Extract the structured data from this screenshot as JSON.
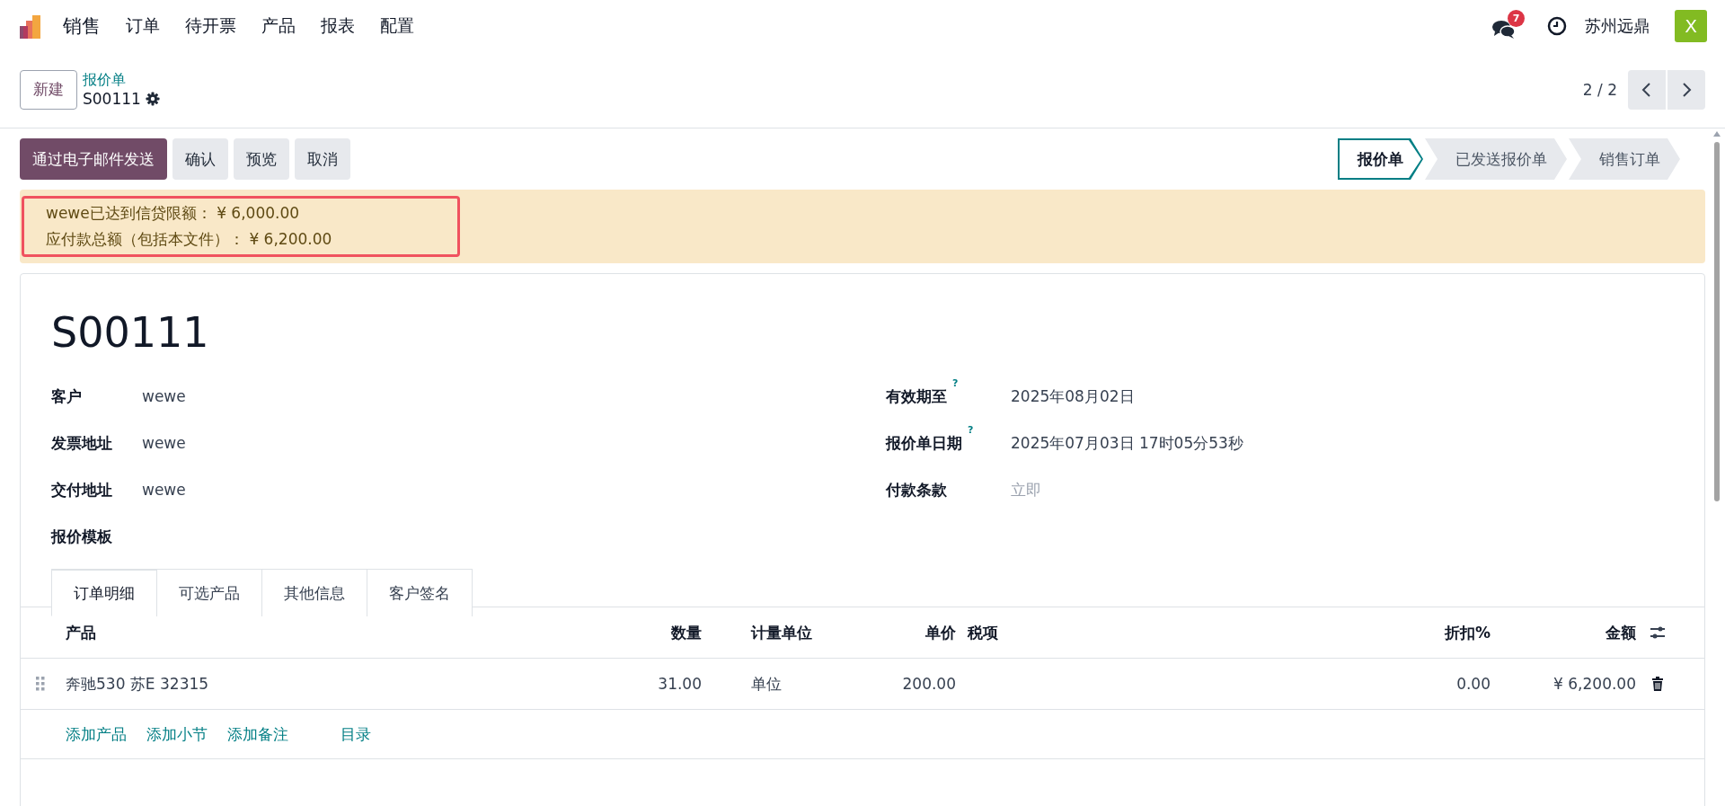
{
  "navbar": {
    "app_name": "销售",
    "menu": [
      "订单",
      "待开票",
      "产品",
      "报表",
      "配置"
    ],
    "message_count": "7",
    "company": "苏州远鼎",
    "avatar": "X"
  },
  "control_panel": {
    "new_button": "新建",
    "breadcrumb": "报价单",
    "record": "S00111",
    "pager": "2 / 2"
  },
  "actions": [
    {
      "label": "通过电子邮件发送",
      "kind": "primary"
    },
    {
      "label": "确认",
      "kind": "secondary"
    },
    {
      "label": "预览",
      "kind": "secondary"
    },
    {
      "label": "取消",
      "kind": "secondary"
    }
  ],
  "status_steps": [
    {
      "label": "报价单",
      "selected": true
    },
    {
      "label": "已发送报价单",
      "selected": false
    },
    {
      "label": "销售订单",
      "selected": false
    }
  ],
  "alert": {
    "highlighted": true,
    "lines": [
      "wewe已达到信贷限额： ¥ 6,000.00",
      "应付款总额（包括本文件）： ¥ 6,200.00"
    ]
  },
  "form": {
    "title": "S00111",
    "left_fields": [
      {
        "label": "客户",
        "value": "wewe"
      },
      {
        "label": "发票地址",
        "value": "wewe"
      },
      {
        "label": "交付地址",
        "value": "wewe"
      },
      {
        "label": "报价模板"
      }
    ],
    "right_fields": [
      {
        "label": "有效期至",
        "help": "?",
        "value": "2025年08月02日"
      },
      {
        "label": "报价单日期",
        "help": "?",
        "value": "2025年07月03日 17时05分53秒"
      },
      {
        "label": "付款条款",
        "placeholder": "立即"
      }
    ]
  },
  "tabs": [
    {
      "label": "订单明细",
      "selected": true
    },
    {
      "label": "可选产品",
      "selected": false
    },
    {
      "label": "其他信息",
      "selected": false
    },
    {
      "label": "客户签名",
      "selected": false
    }
  ],
  "table": {
    "columns": [
      "产品",
      "数量",
      "计量单位",
      "单价",
      "税项",
      "折扣%",
      "金额"
    ],
    "rows": [
      {
        "product": "奔驰530 苏E 32315",
        "quantity": "31.00",
        "uom": "单位",
        "price_unit": "200.00",
        "discount": "0.00",
        "subtotal": "¥ 6,200.00"
      }
    ],
    "add_links": [
      "添加产品",
      "添加小节",
      "添加备注",
      "目录"
    ]
  }
}
